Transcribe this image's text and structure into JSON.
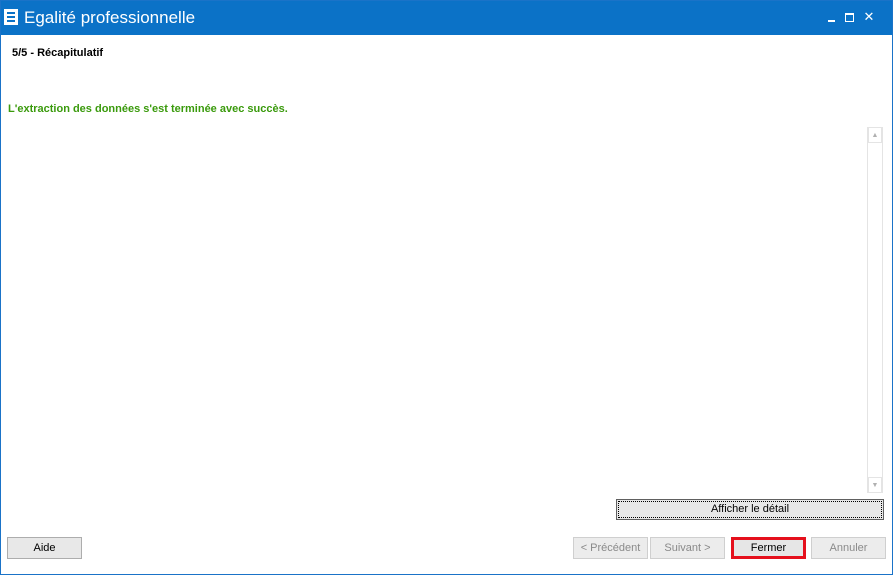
{
  "window": {
    "title": "Egalité professionnelle",
    "icon": "list-document-icon",
    "controls": {
      "minimize_icon": "minimize-icon",
      "maximize_icon": "maximize-icon",
      "close_glyph": "✕"
    }
  },
  "wizard": {
    "step_label": "5/5 - Récapitulatif",
    "status_message": "L'extraction des données s'est terminée avec succès.",
    "status_color": "#3a9a0c"
  },
  "log": {
    "scroll_up": "▲",
    "scroll_down": "▼"
  },
  "buttons": {
    "detail": "Afficher le détail",
    "help": "Aide",
    "previous": "< Précédent",
    "next": "Suivant >",
    "close": "Fermer",
    "cancel": "Annuler"
  },
  "colors": {
    "titlebar": "#0b72c7",
    "highlight": "#e5101c"
  }
}
